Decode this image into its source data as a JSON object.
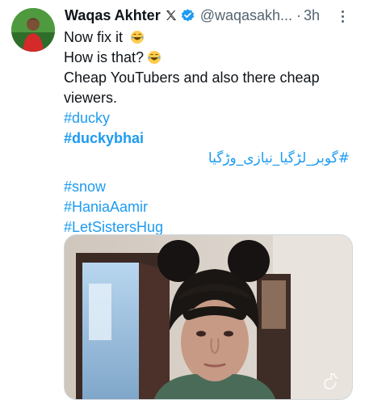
{
  "tweet": {
    "author_name": "Waqas Akhter",
    "handle": "@waqasakh...",
    "separator": "·",
    "time": "3h",
    "lines": [
      "Now fix it",
      "How is that?",
      "Cheap YouTubers and also there cheap viewers."
    ],
    "hashtags": [
      "#ducky",
      "#duckybhai",
      "#گوبر_لڑگیا_نیازی_وڑگیا",
      "#snow",
      "#HaniaAamir",
      "#LetSistersHug"
    ],
    "emoji": "laughing-tears-emoji"
  },
  "colors": {
    "link": "#1d9bf0",
    "secondary_text": "#536471",
    "verified": "#1d9bf0"
  }
}
